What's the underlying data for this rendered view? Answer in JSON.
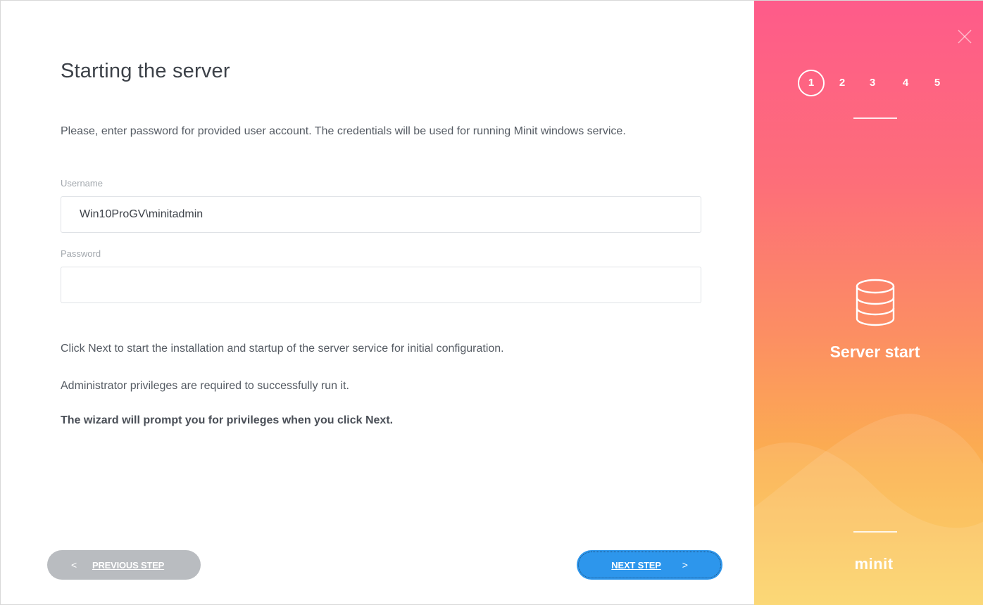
{
  "wizard": {
    "title": "Starting the server",
    "intro": "Please, enter password for provided user account. The credentials will be used for running Minit windows service.",
    "username_label": "Username",
    "username_value": "Win10ProGV\\minitadmin",
    "password_label": "Password",
    "password_value": "",
    "info_line_1": "Click Next to start the installation and startup of the server service for initial configuration.",
    "info_line_2": "Administrator privileges are required to successfully run it.",
    "info_line_3": "The wizard will prompt you for privileges when you click Next.",
    "prev_label": "PREVIOUS STEP",
    "next_label": "NEXT STEP"
  },
  "sidebar": {
    "steps": [
      "1",
      "2",
      "3",
      "4",
      "5"
    ],
    "active_step": "1",
    "section_title": "Server start",
    "logo": "minit"
  },
  "colors": {
    "accent": "#2d96ec",
    "disabled": "#b9bcc0",
    "gradient_top": "#fe5b8a",
    "gradient_bottom": "#fbd057"
  },
  "icons": {
    "close": "close-icon",
    "section": "database-icon",
    "prev": "chevron-left-icon",
    "next": "chevron-right-icon"
  }
}
